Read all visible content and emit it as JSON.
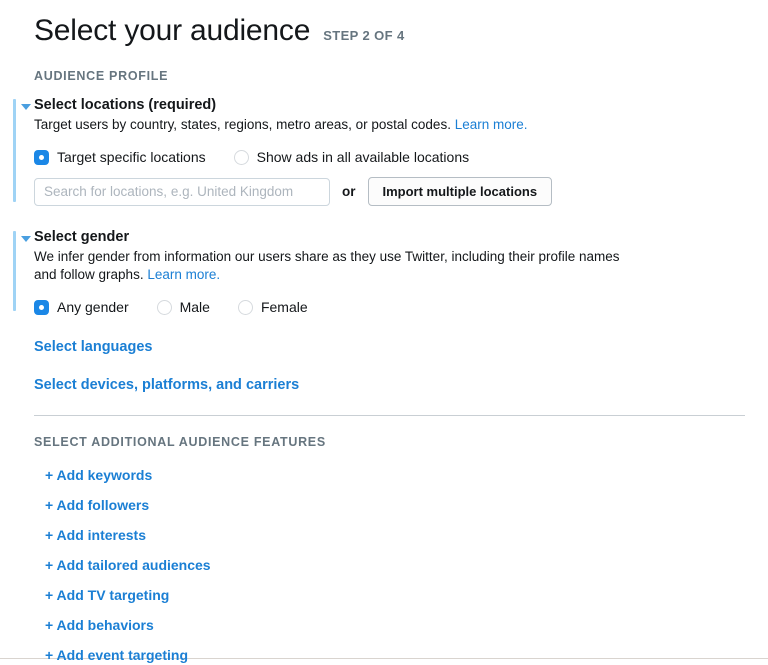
{
  "header": {
    "title": "Select your audience",
    "step": "STEP 2 OF 4"
  },
  "audience_profile_caption": "AUDIENCE PROFILE",
  "locations_section": {
    "title": "Select locations (required)",
    "description": "Target users by country, states, regions, metro areas, or postal codes.",
    "learn_more": "Learn more.",
    "options": [
      {
        "label": "Target specific locations",
        "selected": true
      },
      {
        "label": "Show ads in all available locations",
        "selected": false
      }
    ],
    "search_placeholder": "Search for locations, e.g. United Kingdom",
    "search_value": "",
    "or_label": "or",
    "import_button": "Import multiple locations"
  },
  "gender_section": {
    "title": "Select gender",
    "description": "We infer gender from information our users share as they use Twitter, including their profile names and follow graphs.",
    "learn_more": "Learn more.",
    "options": [
      {
        "label": "Any gender",
        "selected": true
      },
      {
        "label": "Male",
        "selected": false
      },
      {
        "label": "Female",
        "selected": false
      }
    ]
  },
  "extra_links": {
    "languages": "Select languages",
    "devices": "Select devices, platforms, and carriers"
  },
  "additional_features": {
    "caption": "SELECT ADDITIONAL AUDIENCE FEATURES",
    "items": [
      "+ Add keywords",
      "+ Add followers",
      "+ Add interests",
      "+ Add tailored audiences",
      "+ Add TV targeting",
      "+ Add behaviors",
      "+ Add event targeting"
    ]
  },
  "colors": {
    "accent_blue": "#1b87e6",
    "link_blue": "#1b7fd4",
    "muted_slate": "#66757f",
    "accent_bar": "#9fd3f5"
  }
}
